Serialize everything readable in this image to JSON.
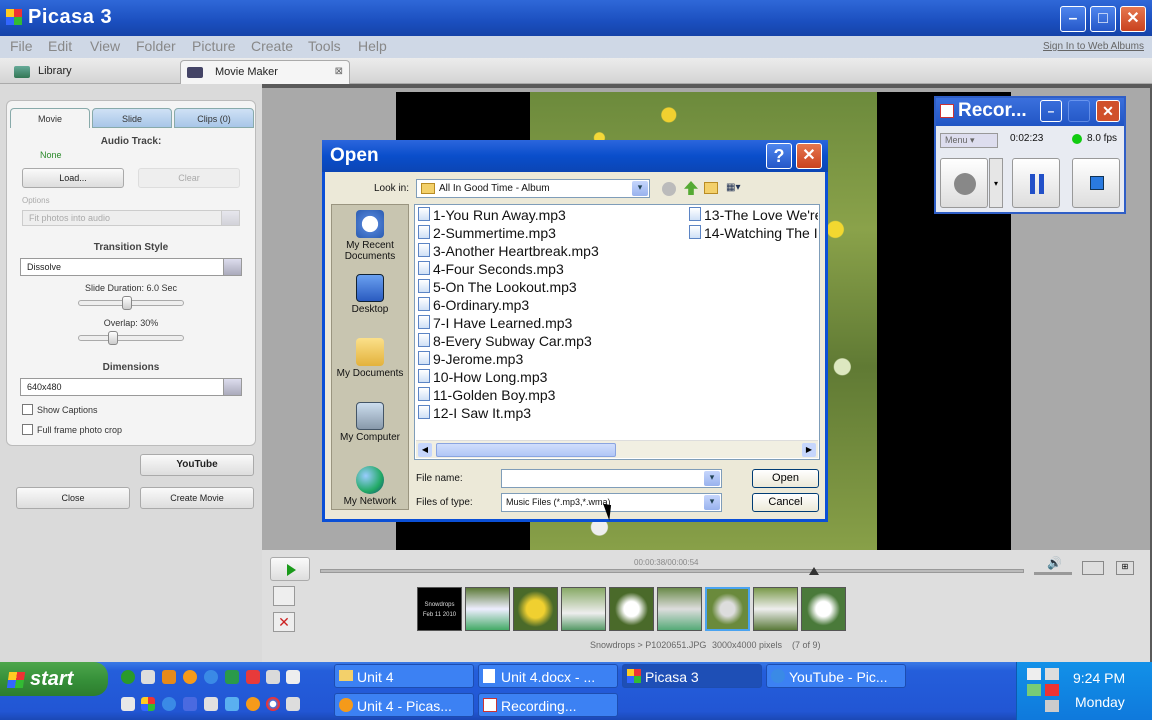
{
  "window": {
    "title": "Picasa 3"
  },
  "menu": [
    "File",
    "Edit",
    "View",
    "Folder",
    "Picture",
    "Create",
    "Tools",
    "Help"
  ],
  "signin": "Sign In to Web Albums",
  "tabs": {
    "library": "Library",
    "movie_maker": "Movie Maker"
  },
  "panel": {
    "tabs": {
      "movie": "Movie",
      "slide": "Slide",
      "clips": "Clips (0)"
    },
    "audio_track": "Audio Track:",
    "audio_value": "None",
    "load": "Load...",
    "clear": "Clear",
    "options": "Options",
    "options_value": "Fit photos into audio",
    "transition_style": "Transition Style",
    "transition_value": "Dissolve",
    "slide_duration": "Slide Duration: 6.0 Sec",
    "slide_duration_level": 0.45,
    "overlap": "Overlap: 30%",
    "overlap_level": 0.3,
    "dimensions": "Dimensions",
    "dimensions_value": "640x480",
    "show_captions": "Show Captions",
    "full_frame": "Full frame photo crop",
    "youtube": "YouTube",
    "close": "Close",
    "create_movie": "Create Movie"
  },
  "recorder": {
    "title": "Recor...",
    "menu": "Menu",
    "time": "0:02:23",
    "fps": "8.0 fps"
  },
  "dialog": {
    "title": "Open",
    "look_in_label": "Look in:",
    "look_in_value": "All In Good Time - Album",
    "places": [
      "My Recent Documents",
      "Desktop",
      "My Documents",
      "My Computer",
      "My Network"
    ],
    "files_col1": [
      "1-You Run Away.mp3",
      "2-Summertime.mp3",
      "3-Another Heartbreak.mp3",
      "4-Four Seconds.mp3",
      "5-On The Lookout.mp3",
      "6-Ordinary.mp3",
      "7-I Have Learned.mp3",
      "8-Every Subway Car.mp3",
      "9-Jerome.mp3",
      "10-How Long.mp3",
      "11-Golden Boy.mp3",
      "12-I Saw It.mp3"
    ],
    "files_col2": [
      "13-The Love We're",
      "14-Watching The I"
    ],
    "file_name_label": "File name:",
    "file_name_value": "",
    "files_of_type_label": "Files of type:",
    "files_of_type_value": "Music Files (*.mp3,*.wma)",
    "open": "Open",
    "cancel": "Cancel"
  },
  "timeline": {
    "time": "00:00:38/00:00:54",
    "progress": 0.7,
    "title_card_line1": "Snowdrops",
    "title_card_line2": "Feb 11 2010",
    "caption": "Snowdrops > P1020651.JPG",
    "dims": "3000x4000 pixels",
    "count": "(7 of 9)"
  },
  "taskbar": {
    "start": "start",
    "tasks": [
      "Unit 4",
      "Unit 4.docx - ...",
      "Picasa 3",
      "YouTube - Pic...",
      "Unit 4 - Picas...",
      "Recording..."
    ],
    "time": "9:24 PM",
    "day": "Monday"
  }
}
